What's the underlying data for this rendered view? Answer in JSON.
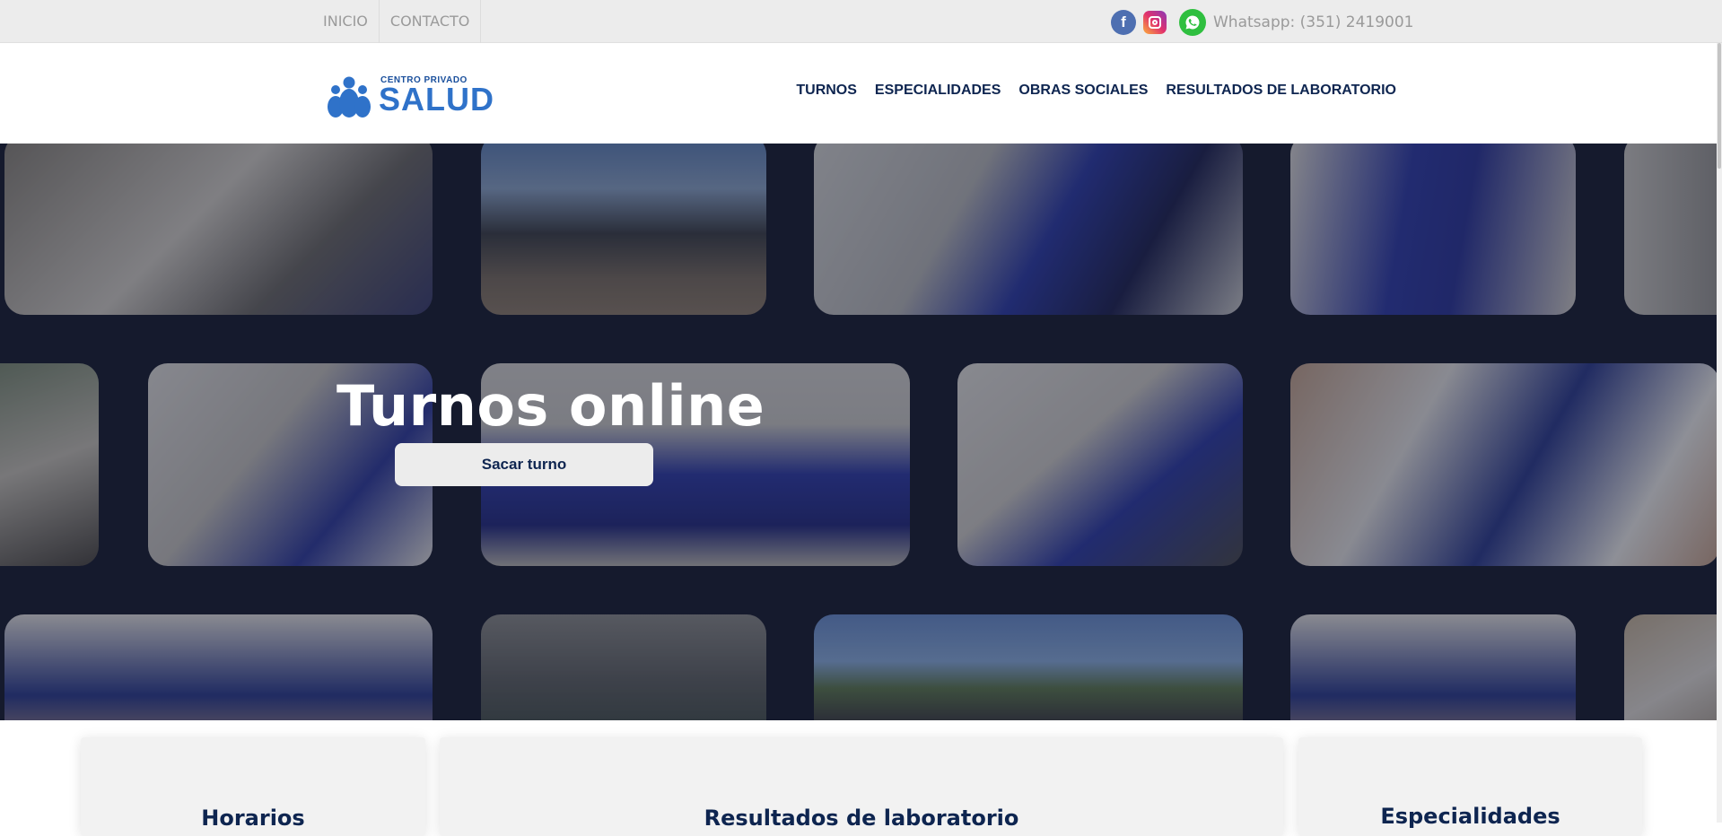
{
  "topbar": {
    "links": [
      "INICIO",
      "CONTACTO"
    ],
    "whatsapp_text": "Whatsapp: (351) 2419001",
    "icons": [
      "facebook-icon",
      "instagram-icon",
      "whatsapp-icon"
    ]
  },
  "header": {
    "logo_small": "CENTRO PRIVADO",
    "logo_big": "SALUD",
    "nav": [
      "TURNOS",
      "ESPECIALIDADES",
      "OBRAS SOCIALES",
      "RESULTADOS DE LABORATORIO"
    ]
  },
  "hero": {
    "title": "Turnos online",
    "button_label": "Sacar turno"
  },
  "cards": {
    "card1_title": "Horarios",
    "card2_title": "Resultados de laboratorio",
    "card3_title": "Especialidades"
  },
  "colors": {
    "brand_blue": "#2f72c9",
    "navy": "#0e2550",
    "hero_bg": "#151a2d"
  }
}
